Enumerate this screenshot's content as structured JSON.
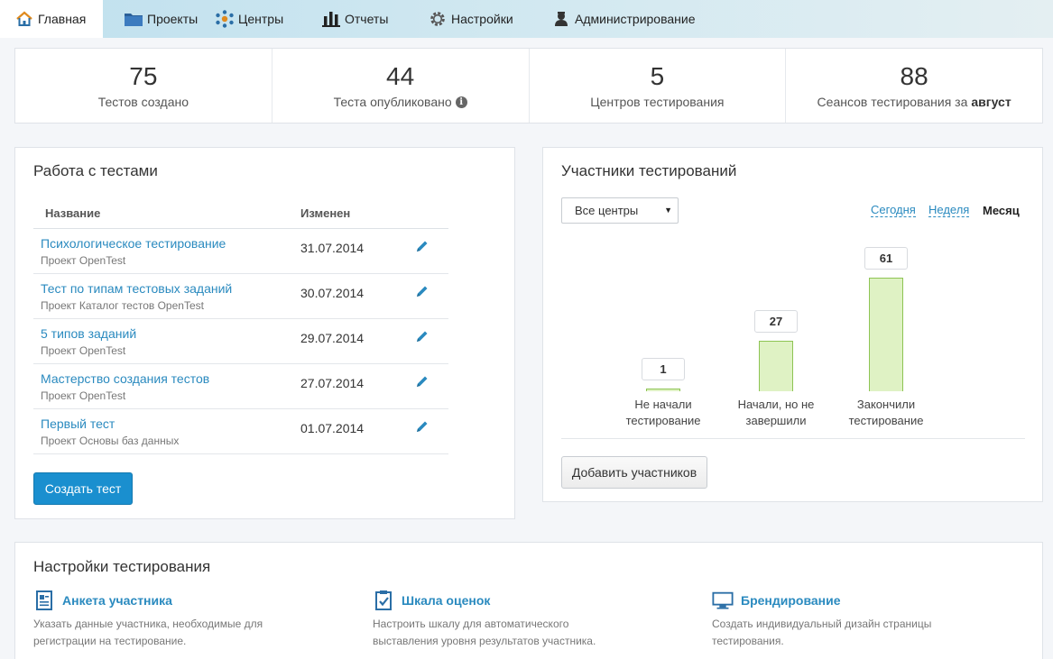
{
  "nav": {
    "items": [
      {
        "label": "Главная",
        "icon": "home-icon",
        "active": true
      },
      {
        "label": "Проекты",
        "icon": "folder-icon"
      },
      {
        "label": "Центры",
        "icon": "network-icon"
      },
      {
        "label": "Отчеты",
        "icon": "bar-chart-icon"
      },
      {
        "label": "Настройки",
        "icon": "gear-icon"
      },
      {
        "label": "Администрирование",
        "icon": "admin-icon"
      }
    ]
  },
  "stats": [
    {
      "value": "75",
      "label": "Тестов создано"
    },
    {
      "value": "44",
      "label": "Теста опубликовано",
      "info_icon": "info-icon"
    },
    {
      "value": "5",
      "label": "Центров тестирования"
    },
    {
      "value": "88",
      "label": "Сеансов тестирования за",
      "label_bold": "август"
    }
  ],
  "tests": {
    "title": "Работа с тестами",
    "columns": {
      "name": "Название",
      "changed": "Изменен"
    },
    "rows": [
      {
        "name": "Психологическое тестирование",
        "project": "Проект OpenTest",
        "date": "31.07.2014"
      },
      {
        "name": "Тест по типам тестовых заданий",
        "project": "Проект Каталог тестов OpenTest",
        "date": "30.07.2014"
      },
      {
        "name": "5 типов заданий",
        "project": "Проект OpenTest",
        "date": "29.07.2014"
      },
      {
        "name": "Мастерство создания тестов",
        "project": "Проект OpenTest",
        "date": "27.07.2014"
      },
      {
        "name": "Первый тест",
        "project": "Проект Основы баз данных",
        "date": "01.07.2014"
      }
    ],
    "create_label": "Создать тест"
  },
  "participants": {
    "title": "Участники тестирований",
    "select_value": "Все центры",
    "periods": {
      "today": "Сегодня",
      "week": "Неделя",
      "month": "Месяц"
    },
    "add_label": "Добавить участников"
  },
  "chart_data": {
    "type": "bar",
    "categories": [
      "Не начали тестирование",
      "Начали, но не завершили",
      "Закончили тестирование"
    ],
    "category_lines": [
      [
        "Не начали",
        "тестирование"
      ],
      [
        "Начали, но не",
        "завершили"
      ],
      [
        "Закончили",
        "тестирование"
      ]
    ],
    "values": [
      1,
      27,
      61
    ],
    "data_labels": [
      "1",
      "27",
      "61"
    ],
    "ylim": [
      0,
      61
    ],
    "colors": {
      "fill": "#dff2c4",
      "stroke": "#8ec454"
    }
  },
  "settings": {
    "title": "Настройки тестирования",
    "items": [
      {
        "title": "Анкета участника",
        "desc": "Указать данные участника, необходимые для регистрации на тестирование.",
        "icon": "form-icon"
      },
      {
        "title": "Шкала оценок",
        "desc": "Настроить шкалу для автоматического выставления уровня результатов участника.",
        "icon": "checklist-icon"
      },
      {
        "title": "Брендирование",
        "desc": "Создать индивидуальный дизайн страницы тестирования.",
        "icon": "monitor-icon"
      }
    ]
  }
}
